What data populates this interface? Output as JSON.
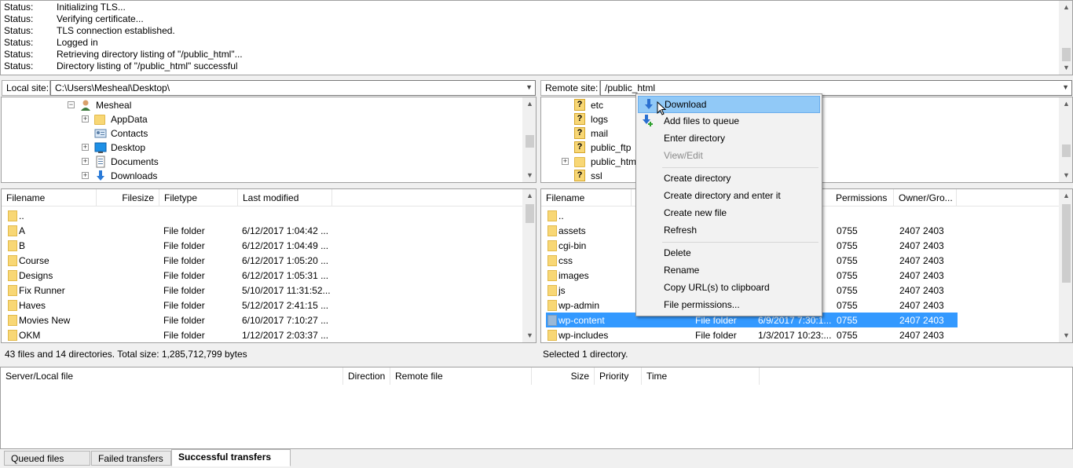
{
  "log": [
    {
      "k": "Status:",
      "v": "Initializing TLS..."
    },
    {
      "k": "Status:",
      "v": "Verifying certificate..."
    },
    {
      "k": "Status:",
      "v": "TLS connection established."
    },
    {
      "k": "Status:",
      "v": "Logged in"
    },
    {
      "k": "Status:",
      "v": "Retrieving directory listing of \"/public_html\"..."
    },
    {
      "k": "Status:",
      "v": "Directory listing of \"/public_html\" successful"
    }
  ],
  "local": {
    "label": "Local site:",
    "path": "C:\\Users\\Mesheal\\Desktop\\",
    "tree": [
      "Mesheal",
      "AppData",
      "Contacts",
      "Desktop",
      "Documents",
      "Downloads"
    ],
    "headers": [
      "Filename",
      "Filesize",
      "Filetype",
      "Last modified"
    ],
    "files": [
      {
        "name": "..",
        "size": "",
        "type": "",
        "modified": ""
      },
      {
        "name": "A",
        "size": "",
        "type": "File folder",
        "modified": "6/12/2017 1:04:42 ..."
      },
      {
        "name": "B",
        "size": "",
        "type": "File folder",
        "modified": "6/12/2017 1:04:49 ..."
      },
      {
        "name": "Course",
        "size": "",
        "type": "File folder",
        "modified": "6/12/2017 1:05:20 ..."
      },
      {
        "name": "Designs",
        "size": "",
        "type": "File folder",
        "modified": "6/12/2017 1:05:31 ..."
      },
      {
        "name": "Fix Runner",
        "size": "",
        "type": "File folder",
        "modified": "5/10/2017 11:31:52..."
      },
      {
        "name": "Haves",
        "size": "",
        "type": "File folder",
        "modified": "5/12/2017 2:41:15 ..."
      },
      {
        "name": "Movies New",
        "size": "",
        "type": "File folder",
        "modified": "6/10/2017 7:10:27 ..."
      },
      {
        "name": "OKM",
        "size": "",
        "type": "File folder",
        "modified": "1/12/2017 2:03:37 ..."
      }
    ],
    "status": "43 files and 14 directories. Total size: 1,285,712,799 bytes"
  },
  "remote": {
    "label": "Remote site:",
    "path": "/public_html",
    "tree": [
      "etc",
      "logs",
      "mail",
      "public_ftp",
      "public_html",
      "ssl"
    ],
    "headers": [
      "Filename",
      "Permissions",
      "Owner/Gro..."
    ],
    "files": [
      {
        "name": "..",
        "type": "",
        "modified": "",
        "perm": "",
        "owner": ""
      },
      {
        "name": "assets",
        "type": "",
        "modified": "",
        "perm": "0755",
        "owner": "2407 2403"
      },
      {
        "name": "cgi-bin",
        "type": "",
        "modified": "",
        "perm": "0755",
        "owner": "2407 2403"
      },
      {
        "name": "css",
        "type": "",
        "modified": "",
        "perm": "0755",
        "owner": "2407 2403"
      },
      {
        "name": "images",
        "type": "",
        "modified": "",
        "perm": "0755",
        "owner": "2407 2403"
      },
      {
        "name": "js",
        "type": "",
        "modified": "",
        "perm": "0755",
        "owner": "2407 2403"
      },
      {
        "name": "wp-admin",
        "type": "",
        "modified": "",
        "perm": "0755",
        "owner": "2407 2403"
      },
      {
        "name": "wp-content",
        "type": "File folder",
        "modified": "6/9/2017 7:30:1...",
        "perm": "0755",
        "owner": "2407 2403"
      },
      {
        "name": "wp-includes",
        "type": "File folder",
        "modified": "1/3/2017 10:23:...",
        "perm": "0755",
        "owner": "2407 2403"
      }
    ],
    "status": "Selected 1 directory."
  },
  "context_menu": {
    "items": [
      {
        "label": "Download",
        "icon": "download-arrow-icon"
      },
      {
        "label": "Add files to queue",
        "icon": "add-to-queue-icon"
      },
      {
        "label": "Enter directory"
      },
      {
        "label": "View/Edit"
      },
      {
        "label": "Create directory"
      },
      {
        "label": "Create directory and enter it"
      },
      {
        "label": "Create new file"
      },
      {
        "label": "Refresh"
      },
      {
        "label": "Delete"
      },
      {
        "label": "Rename"
      },
      {
        "label": "Copy URL(s) to clipboard"
      },
      {
        "label": "File permissions..."
      }
    ]
  },
  "queue": {
    "headers": [
      "Server/Local file",
      "Direction",
      "Remote file",
      "Size",
      "Priority",
      "Time"
    ],
    "tabs": [
      "Queued files",
      "Failed transfers",
      "Successful transfers"
    ]
  },
  "colors": {
    "selection": "#3399ff",
    "menu_highlight": "#91c9f7",
    "folder": "#f8d775"
  }
}
